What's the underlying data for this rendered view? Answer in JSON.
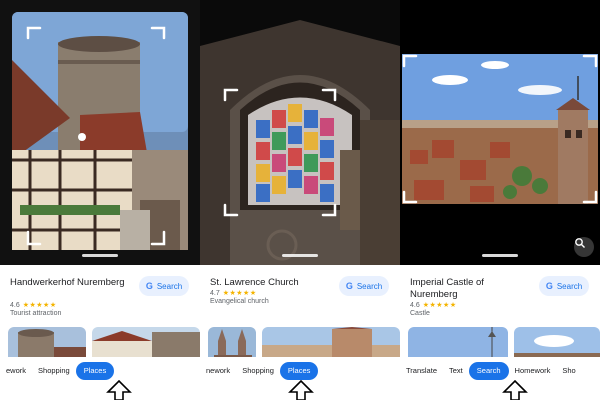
{
  "panels": [
    {
      "place": "Handwerkerhof Nuremberg",
      "rating": "4.6",
      "stars": "★★★★★",
      "subtitle": "Tourist attraction",
      "search_label": "Search",
      "tabs": [
        "ework",
        "Shopping",
        "Places"
      ],
      "active_tab": "Places"
    },
    {
      "place": "St. Lawrence Church",
      "rating": "4.7",
      "stars": "★★★★★",
      "subtitle": "Evangelical church",
      "search_label": "Search",
      "tabs": [
        "nework",
        "Shopping",
        "Places"
      ],
      "active_tab": "Places"
    },
    {
      "place": "Imperial Castle of Nuremberg",
      "rating": "4.6",
      "stars": "★★★★★",
      "subtitle": "Castle",
      "search_label": "Search",
      "tabs": [
        "Translate",
        "Text",
        "Search",
        "Homework",
        "Sho"
      ],
      "active_tab": "Search"
    }
  ],
  "colors": {
    "accent": "#1a73e8",
    "chip_bg": "#e8f0fe",
    "star": "#f4b400"
  },
  "icons": {
    "search_chip": "google-g-icon",
    "lens_button": "lens-icon",
    "pointer": "up-arrow-icon"
  }
}
